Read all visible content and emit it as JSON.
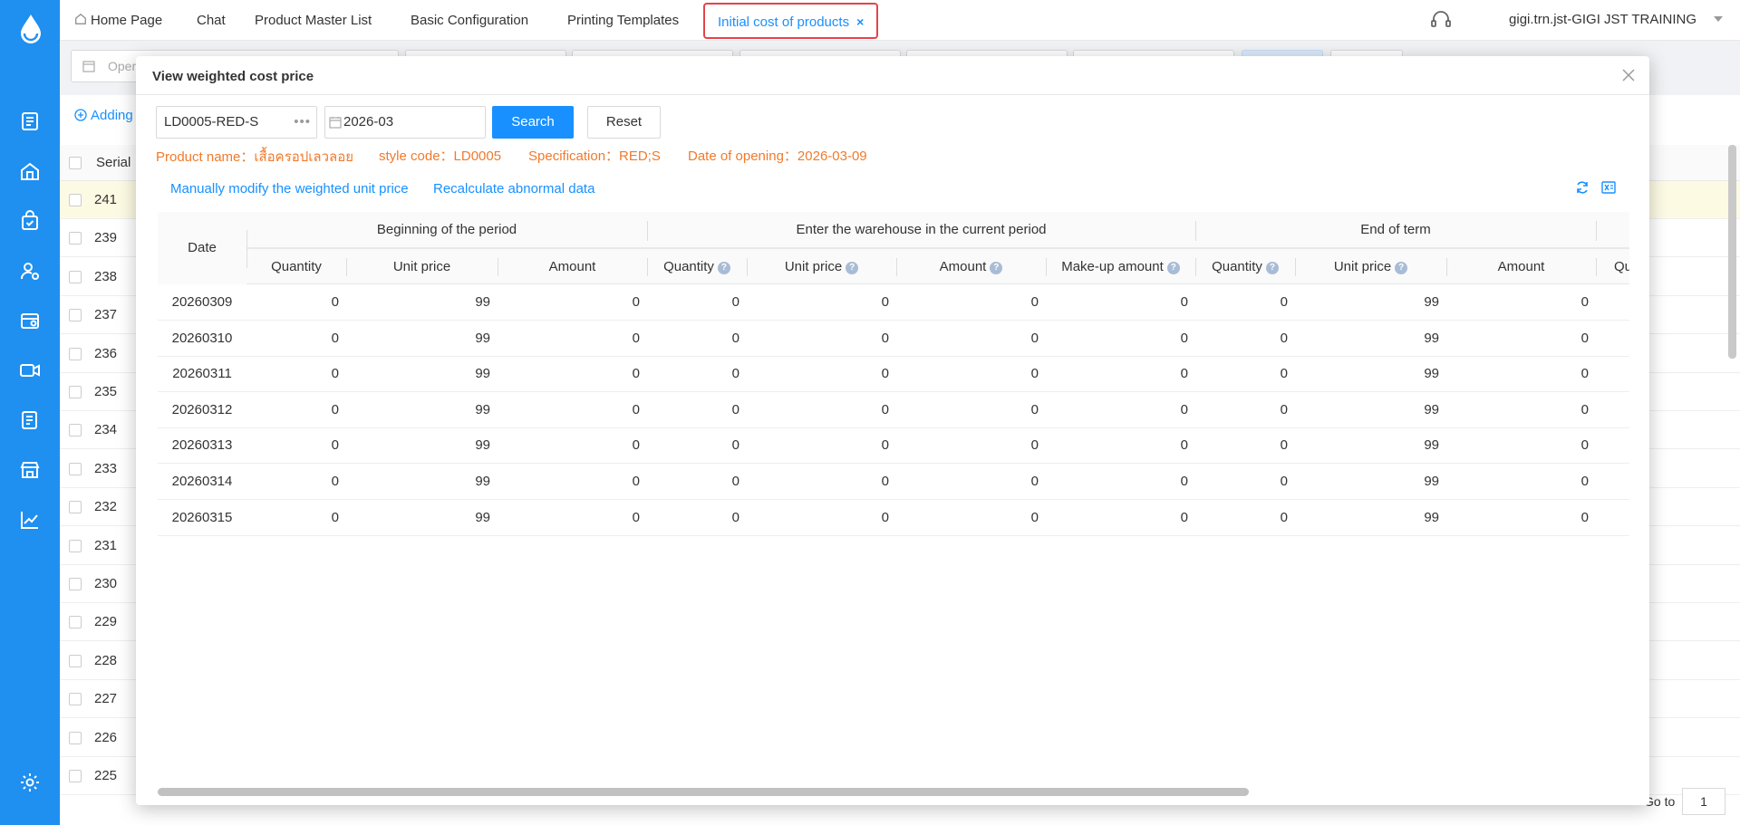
{
  "topbar": {
    "tabs": [
      {
        "label": "Home Page",
        "name": "tab-home-page"
      },
      {
        "label": "Chat",
        "name": "tab-chat"
      },
      {
        "label": "Product Master List",
        "name": "tab-product-master-list"
      },
      {
        "label": "Basic Configuration",
        "name": "tab-basic-configuration"
      },
      {
        "label": "Printing Templates",
        "name": "tab-printing-templates"
      }
    ],
    "active_tab": {
      "label": "Initial cost of products",
      "close": "×"
    },
    "user": "gigi.trn.jst-GIGI JST TRAINING"
  },
  "sidebar": {
    "icons": [
      "document-icon",
      "home-building-icon",
      "bag-check-icon",
      "user-settings-icon",
      "store-settings-icon",
      "video-icon",
      "notes-edit-icon",
      "shop-icon",
      "trend-chart-icon",
      "gear-icon"
    ]
  },
  "background": {
    "filter_placeholder": "Oper",
    "add_label": "Adding",
    "column_serial": "Serial",
    "rows": [
      "241",
      "239",
      "238",
      "237",
      "236",
      "235",
      "234",
      "233",
      "232",
      "231",
      "230",
      "229",
      "228",
      "227",
      "226",
      "225"
    ],
    "goto_label": "Go to",
    "goto_value": "1"
  },
  "modal": {
    "title": "View weighted cost price",
    "product_code": "LD0005-RED-S",
    "period": "2026-03",
    "search_label": "Search",
    "reset_label": "Reset",
    "info": {
      "product_name": "Product name：เสื้อครอปเลวลอย",
      "style_code": "style code：LD0005",
      "specification": "Specification：RED;S",
      "date_of_opening": "Date of opening：2026-03-09"
    },
    "links": {
      "manual_modify": "Manually modify the weighted unit price",
      "recalculate": "Recalculate abnormal data"
    },
    "table": {
      "date_header": "Date",
      "groups": [
        "Beginning of the period",
        "Enter the warehouse in the current period",
        "End of term"
      ],
      "columns": [
        "Quantity",
        "Unit price",
        "Amount",
        "Quantity",
        "Unit price",
        "Amount",
        "Make-up amount",
        "Quantity",
        "Unit price",
        "Amount",
        "Qu"
      ],
      "help_mark": "?",
      "rows": [
        {
          "date": "20260309",
          "values": [
            "0",
            "99",
            "0",
            "0",
            "0",
            "0",
            "0",
            "0",
            "99",
            "0"
          ]
        },
        {
          "date": "20260310",
          "values": [
            "0",
            "99",
            "0",
            "0",
            "0",
            "0",
            "0",
            "0",
            "99",
            "0"
          ]
        },
        {
          "date": "20260311",
          "values": [
            "0",
            "99",
            "0",
            "0",
            "0",
            "0",
            "0",
            "0",
            "99",
            "0"
          ]
        },
        {
          "date": "20260312",
          "values": [
            "0",
            "99",
            "0",
            "0",
            "0",
            "0",
            "0",
            "0",
            "99",
            "0"
          ]
        },
        {
          "date": "20260313",
          "values": [
            "0",
            "99",
            "0",
            "0",
            "0",
            "0",
            "0",
            "0",
            "99",
            "0"
          ]
        },
        {
          "date": "20260314",
          "values": [
            "0",
            "99",
            "0",
            "0",
            "0",
            "0",
            "0",
            "0",
            "99",
            "0"
          ]
        },
        {
          "date": "20260315",
          "values": [
            "0",
            "99",
            "0",
            "0",
            "0",
            "0",
            "0",
            "0",
            "99",
            "0"
          ]
        }
      ]
    }
  },
  "colors": {
    "sidebar": "#1f8ff0",
    "accent": "#1890ff",
    "info_text": "#f07a2c",
    "active_tab_border": "#e5434b"
  }
}
